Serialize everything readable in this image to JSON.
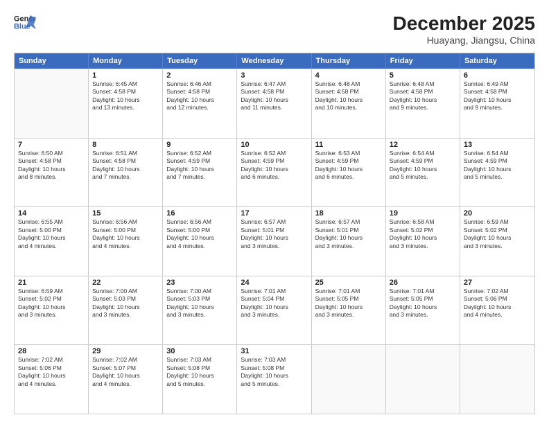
{
  "header": {
    "logo_line1": "General",
    "logo_line2": "Blue",
    "title": "December 2025",
    "subtitle": "Huayang, Jiangsu, China"
  },
  "days": [
    "Sunday",
    "Monday",
    "Tuesday",
    "Wednesday",
    "Thursday",
    "Friday",
    "Saturday"
  ],
  "rows": [
    [
      {
        "day": null,
        "num": "",
        "lines": []
      },
      {
        "day": 1,
        "num": "1",
        "lines": [
          "Sunrise: 6:45 AM",
          "Sunset: 4:58 PM",
          "Daylight: 10 hours",
          "and 13 minutes."
        ]
      },
      {
        "day": 2,
        "num": "2",
        "lines": [
          "Sunrise: 6:46 AM",
          "Sunset: 4:58 PM",
          "Daylight: 10 hours",
          "and 12 minutes."
        ]
      },
      {
        "day": 3,
        "num": "3",
        "lines": [
          "Sunrise: 6:47 AM",
          "Sunset: 4:58 PM",
          "Daylight: 10 hours",
          "and 11 minutes."
        ]
      },
      {
        "day": 4,
        "num": "4",
        "lines": [
          "Sunrise: 6:48 AM",
          "Sunset: 4:58 PM",
          "Daylight: 10 hours",
          "and 10 minutes."
        ]
      },
      {
        "day": 5,
        "num": "5",
        "lines": [
          "Sunrise: 6:48 AM",
          "Sunset: 4:58 PM",
          "Daylight: 10 hours",
          "and 9 minutes."
        ]
      },
      {
        "day": 6,
        "num": "6",
        "lines": [
          "Sunrise: 6:49 AM",
          "Sunset: 4:58 PM",
          "Daylight: 10 hours",
          "and 9 minutes."
        ]
      }
    ],
    [
      {
        "day": 7,
        "num": "7",
        "lines": [
          "Sunrise: 6:50 AM",
          "Sunset: 4:58 PM",
          "Daylight: 10 hours",
          "and 8 minutes."
        ]
      },
      {
        "day": 8,
        "num": "8",
        "lines": [
          "Sunrise: 6:51 AM",
          "Sunset: 4:58 PM",
          "Daylight: 10 hours",
          "and 7 minutes."
        ]
      },
      {
        "day": 9,
        "num": "9",
        "lines": [
          "Sunrise: 6:52 AM",
          "Sunset: 4:59 PM",
          "Daylight: 10 hours",
          "and 7 minutes."
        ]
      },
      {
        "day": 10,
        "num": "10",
        "lines": [
          "Sunrise: 6:52 AM",
          "Sunset: 4:59 PM",
          "Daylight: 10 hours",
          "and 6 minutes."
        ]
      },
      {
        "day": 11,
        "num": "11",
        "lines": [
          "Sunrise: 6:53 AM",
          "Sunset: 4:59 PM",
          "Daylight: 10 hours",
          "and 6 minutes."
        ]
      },
      {
        "day": 12,
        "num": "12",
        "lines": [
          "Sunrise: 6:54 AM",
          "Sunset: 4:59 PM",
          "Daylight: 10 hours",
          "and 5 minutes."
        ]
      },
      {
        "day": 13,
        "num": "13",
        "lines": [
          "Sunrise: 6:54 AM",
          "Sunset: 4:59 PM",
          "Daylight: 10 hours",
          "and 5 minutes."
        ]
      }
    ],
    [
      {
        "day": 14,
        "num": "14",
        "lines": [
          "Sunrise: 6:55 AM",
          "Sunset: 5:00 PM",
          "Daylight: 10 hours",
          "and 4 minutes."
        ]
      },
      {
        "day": 15,
        "num": "15",
        "lines": [
          "Sunrise: 6:56 AM",
          "Sunset: 5:00 PM",
          "Daylight: 10 hours",
          "and 4 minutes."
        ]
      },
      {
        "day": 16,
        "num": "16",
        "lines": [
          "Sunrise: 6:56 AM",
          "Sunset: 5:00 PM",
          "Daylight: 10 hours",
          "and 4 minutes."
        ]
      },
      {
        "day": 17,
        "num": "17",
        "lines": [
          "Sunrise: 6:57 AM",
          "Sunset: 5:01 PM",
          "Daylight: 10 hours",
          "and 3 minutes."
        ]
      },
      {
        "day": 18,
        "num": "18",
        "lines": [
          "Sunrise: 6:57 AM",
          "Sunset: 5:01 PM",
          "Daylight: 10 hours",
          "and 3 minutes."
        ]
      },
      {
        "day": 19,
        "num": "19",
        "lines": [
          "Sunrise: 6:58 AM",
          "Sunset: 5:02 PM",
          "Daylight: 10 hours",
          "and 3 minutes."
        ]
      },
      {
        "day": 20,
        "num": "20",
        "lines": [
          "Sunrise: 6:59 AM",
          "Sunset: 5:02 PM",
          "Daylight: 10 hours",
          "and 3 minutes."
        ]
      }
    ],
    [
      {
        "day": 21,
        "num": "21",
        "lines": [
          "Sunrise: 6:59 AM",
          "Sunset: 5:02 PM",
          "Daylight: 10 hours",
          "and 3 minutes."
        ]
      },
      {
        "day": 22,
        "num": "22",
        "lines": [
          "Sunrise: 7:00 AM",
          "Sunset: 5:03 PM",
          "Daylight: 10 hours",
          "and 3 minutes."
        ]
      },
      {
        "day": 23,
        "num": "23",
        "lines": [
          "Sunrise: 7:00 AM",
          "Sunset: 5:03 PM",
          "Daylight: 10 hours",
          "and 3 minutes."
        ]
      },
      {
        "day": 24,
        "num": "24",
        "lines": [
          "Sunrise: 7:01 AM",
          "Sunset: 5:04 PM",
          "Daylight: 10 hours",
          "and 3 minutes."
        ]
      },
      {
        "day": 25,
        "num": "25",
        "lines": [
          "Sunrise: 7:01 AM",
          "Sunset: 5:05 PM",
          "Daylight: 10 hours",
          "and 3 minutes."
        ]
      },
      {
        "day": 26,
        "num": "26",
        "lines": [
          "Sunrise: 7:01 AM",
          "Sunset: 5:05 PM",
          "Daylight: 10 hours",
          "and 3 minutes."
        ]
      },
      {
        "day": 27,
        "num": "27",
        "lines": [
          "Sunrise: 7:02 AM",
          "Sunset: 5:06 PM",
          "Daylight: 10 hours",
          "and 4 minutes."
        ]
      }
    ],
    [
      {
        "day": 28,
        "num": "28",
        "lines": [
          "Sunrise: 7:02 AM",
          "Sunset: 5:06 PM",
          "Daylight: 10 hours",
          "and 4 minutes."
        ]
      },
      {
        "day": 29,
        "num": "29",
        "lines": [
          "Sunrise: 7:02 AM",
          "Sunset: 5:07 PM",
          "Daylight: 10 hours",
          "and 4 minutes."
        ]
      },
      {
        "day": 30,
        "num": "30",
        "lines": [
          "Sunrise: 7:03 AM",
          "Sunset: 5:08 PM",
          "Daylight: 10 hours",
          "and 5 minutes."
        ]
      },
      {
        "day": 31,
        "num": "31",
        "lines": [
          "Sunrise: 7:03 AM",
          "Sunset: 5:08 PM",
          "Daylight: 10 hours",
          "and 5 minutes."
        ]
      },
      {
        "day": null,
        "num": "",
        "lines": []
      },
      {
        "day": null,
        "num": "",
        "lines": []
      },
      {
        "day": null,
        "num": "",
        "lines": []
      }
    ]
  ]
}
